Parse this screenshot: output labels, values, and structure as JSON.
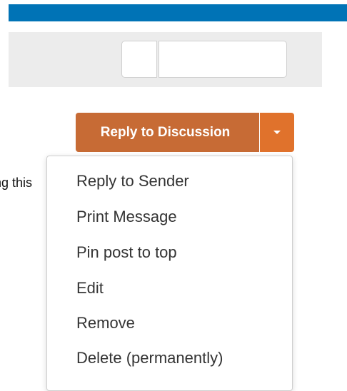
{
  "reply": {
    "label": "Reply to Discussion",
    "caret_icon": "caret-down-icon",
    "primary_color": "#c76b35",
    "toggle_color": "#e0722c"
  },
  "snippet": {
    "text": "ng this"
  },
  "dropdown": {
    "items": [
      {
        "label": "Reply to Sender"
      },
      {
        "label": "Print Message"
      },
      {
        "label": "Pin post to top"
      },
      {
        "label": "Edit"
      },
      {
        "label": "Remove"
      },
      {
        "label": "Delete (permanently)"
      }
    ]
  },
  "colors": {
    "header_bar": "#0073b6",
    "toolbar_bg": "#ececec"
  }
}
